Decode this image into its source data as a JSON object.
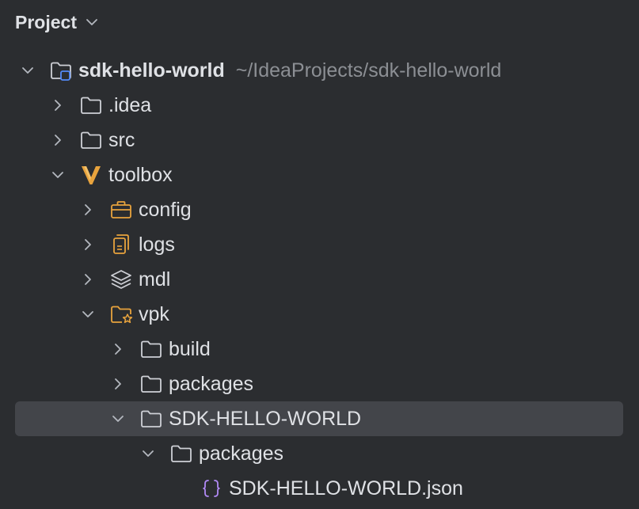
{
  "header": {
    "title": "Project",
    "chevron_icon": "chevron-down-icon"
  },
  "tree": {
    "root": {
      "label": "sdk-hello-world",
      "path": "~/IdeaProjects/sdk-hello-world",
      "icon": "module-folder-icon",
      "expanded": true
    },
    "idea": {
      "label": ".idea",
      "icon": "folder-icon",
      "expanded": false
    },
    "src": {
      "label": "src",
      "icon": "folder-icon",
      "expanded": false
    },
    "toolbox": {
      "label": "toolbox",
      "icon": "vault-logo-icon",
      "expanded": true
    },
    "config": {
      "label": "config",
      "icon": "briefcase-icon",
      "expanded": false
    },
    "logs": {
      "label": "logs",
      "icon": "documents-icon",
      "expanded": false
    },
    "mdl": {
      "label": "mdl",
      "icon": "layers-icon",
      "expanded": false
    },
    "vpk": {
      "label": "vpk",
      "icon": "star-folder-icon",
      "expanded": true
    },
    "build": {
      "label": "build",
      "icon": "folder-icon",
      "expanded": false
    },
    "packages": {
      "label": "packages",
      "icon": "folder-icon",
      "expanded": false
    },
    "sdk_hello_world": {
      "label": "SDK-HELLO-WORLD",
      "icon": "folder-icon",
      "expanded": true,
      "selected": true
    },
    "sub_packages": {
      "label": "packages",
      "icon": "folder-icon",
      "expanded": true
    },
    "json_file": {
      "label": "SDK-HELLO-WORLD.json",
      "icon": "json-file-icon"
    }
  },
  "colors": {
    "background": "#2b2d30",
    "selection": "#43454a",
    "text": "#dfe1e5",
    "path_text": "#8c8f94",
    "orange_accent": "#e8a33d",
    "json_purple": "#b189f5",
    "module_blue": "#548af7"
  }
}
